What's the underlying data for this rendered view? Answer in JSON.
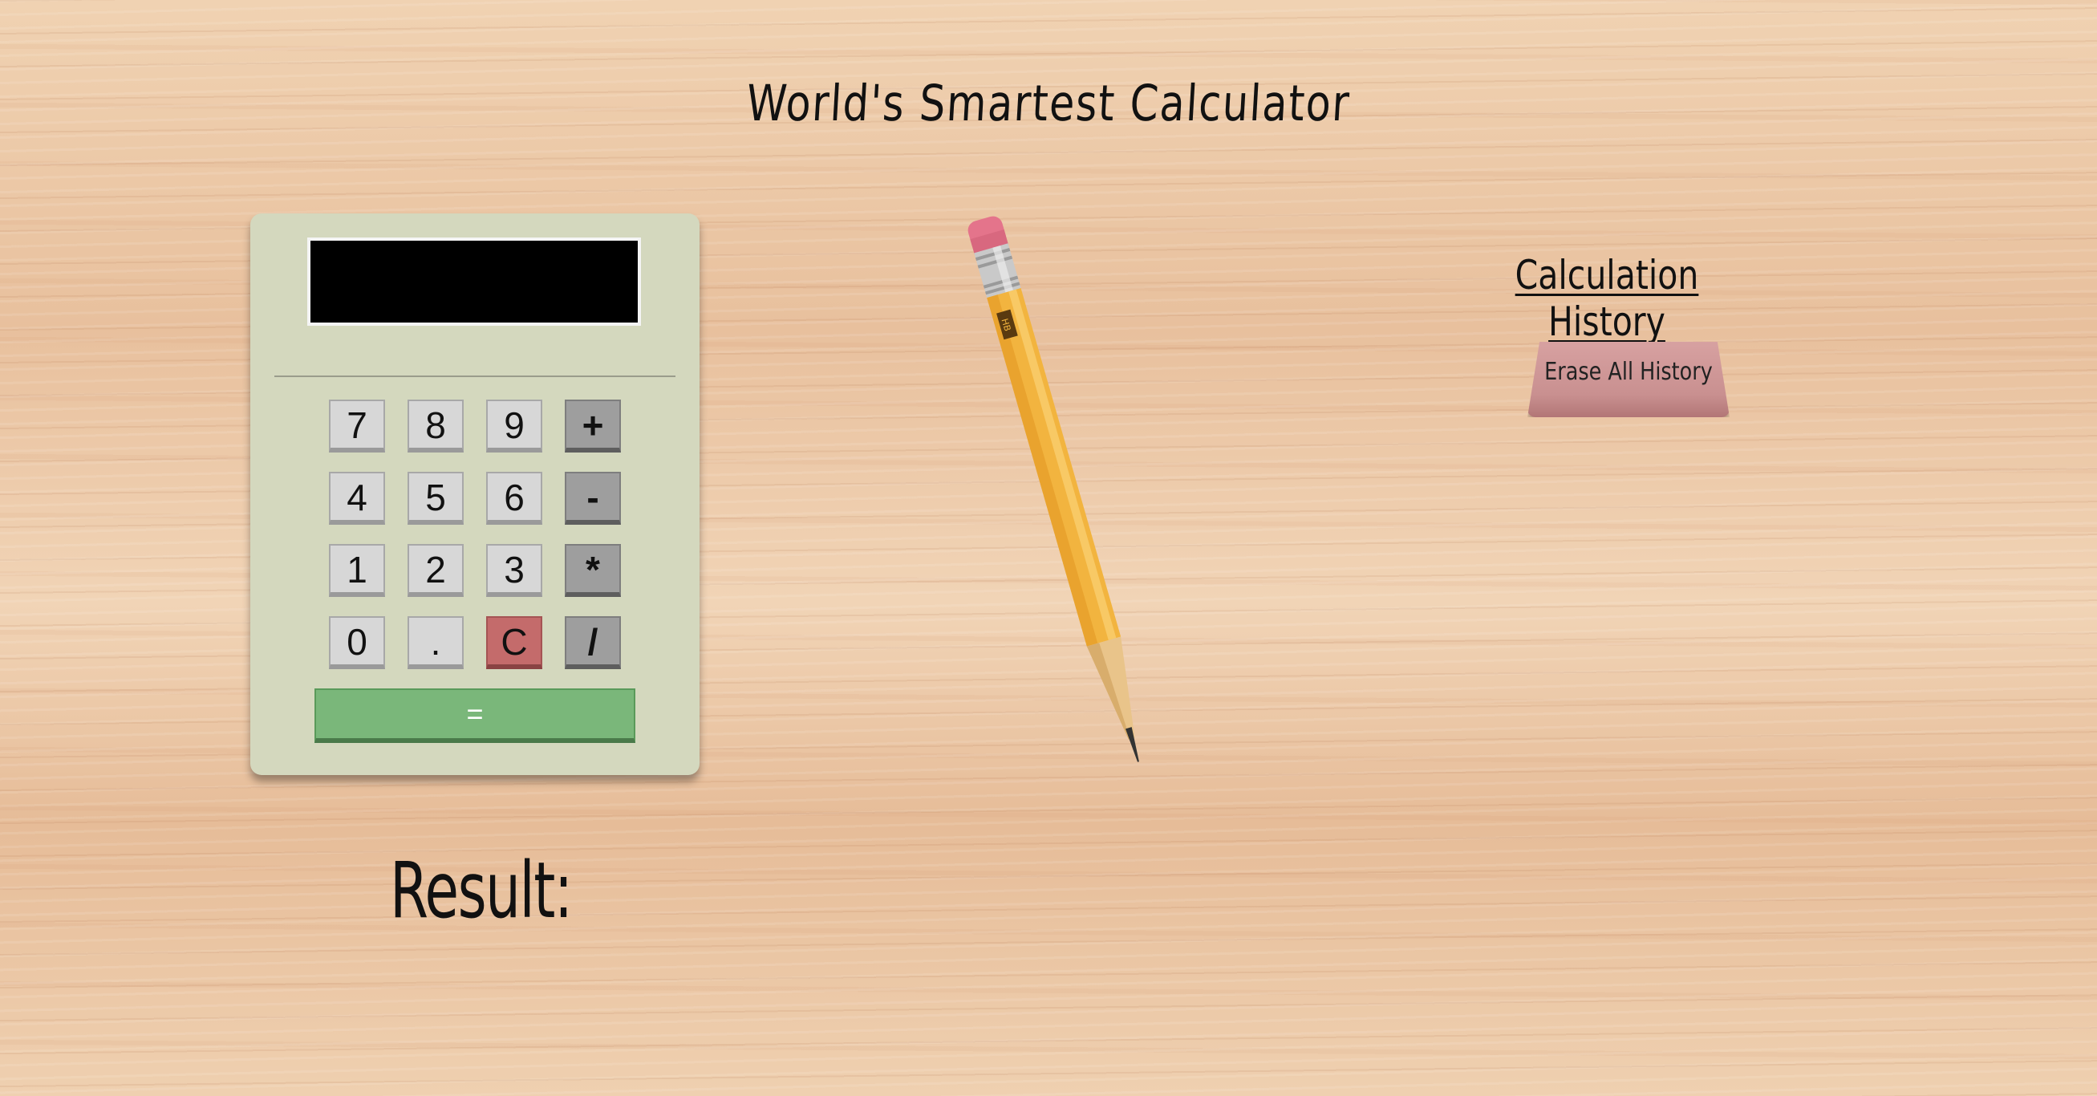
{
  "page": {
    "title": "World's Smartest Calculator"
  },
  "calculator": {
    "display_value": "",
    "keys": {
      "k7": "7",
      "k8": "8",
      "k9": "9",
      "plus": "+",
      "k4": "4",
      "k5": "5",
      "k6": "6",
      "minus": "-",
      "k1": "1",
      "k2": "2",
      "k3": "3",
      "multiply": "*",
      "k0": "0",
      "dot": ".",
      "clear": "C",
      "divide": "/",
      "equals": "="
    },
    "colors": {
      "body": "#d4d8be",
      "display": "#000000",
      "number_key": "#d7d7d7",
      "operator_key": "#9e9e9e",
      "clear_key": "#c46b6b",
      "equals_key": "#7ab77a"
    }
  },
  "result": {
    "label": "Result:",
    "value": ""
  },
  "pencil": {
    "grade": "HB"
  },
  "history": {
    "title": "Calculation History",
    "erase_button": "Erase All History",
    "entries": []
  }
}
